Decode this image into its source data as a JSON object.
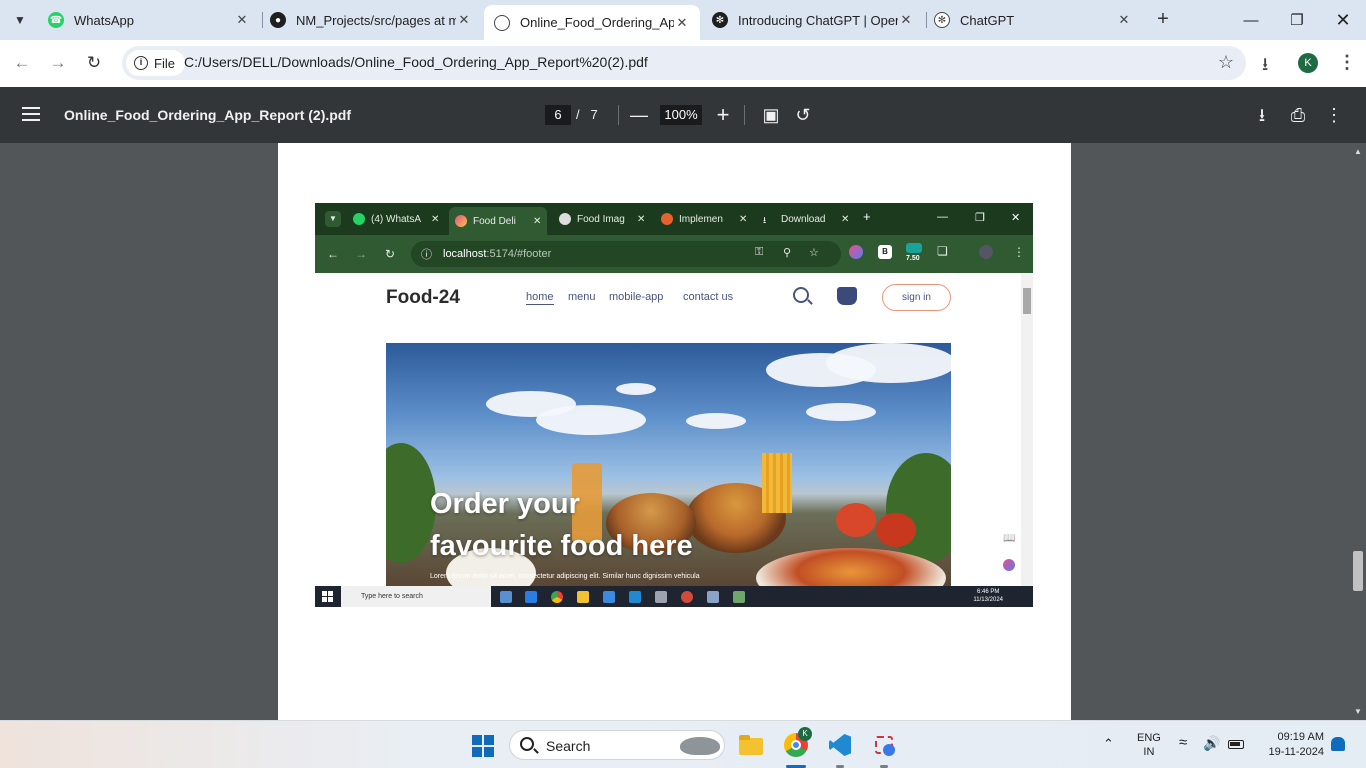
{
  "browser": {
    "tabs": [
      {
        "title": "WhatsApp",
        "icon": "whatsapp-icon",
        "active": false
      },
      {
        "title": "NM_Projects/src/pages at m",
        "icon": "github-icon",
        "active": false
      },
      {
        "title": "Online_Food_Ordering_App_",
        "icon": "globe-icon",
        "active": true
      },
      {
        "title": "Introducing ChatGPT | Open",
        "icon": "openai-icon",
        "active": false
      },
      {
        "title": "ChatGPT",
        "icon": "openai-icon",
        "active": false
      }
    ],
    "address": {
      "chip_label": "File",
      "url": "C:/Users/DELL/Downloads/Online_Food_Ordering_App_Report%20(2).pdf"
    },
    "profile_initial": "K"
  },
  "pdf_viewer": {
    "document_name": "Online_Food_Ordering_App_Report (2).pdf",
    "current_page": "6",
    "page_separator": "/",
    "total_pages": "7",
    "zoom": "100%"
  },
  "embedded_screenshot": {
    "tabs": [
      {
        "title": "(4) WhatsA",
        "active": false
      },
      {
        "title": "Food Deli",
        "active": true
      },
      {
        "title": "Food Imag",
        "active": false
      },
      {
        "title": "Implemen",
        "active": false
      },
      {
        "title": "Download",
        "active": false
      }
    ],
    "url_host": "localhost",
    "url_rest": ":5174/#footer",
    "extension_badge": "7.50",
    "extension_b": "B",
    "site": {
      "logo": "Food-24",
      "menu": [
        "home",
        "menu",
        "mobile-app",
        "contact us"
      ],
      "active_menu": "home",
      "signin_label": "sign in",
      "hero_title_line1": "Order your",
      "hero_title_line2": "favourite food here",
      "hero_subtext": "Lorem ipsum dolor sit amet, consectetur adipiscing elit. Similar hunc dignissim vehicula"
    },
    "taskbar": {
      "search_placeholder": "Type here to search",
      "time": "6:46 PM",
      "date": "11/13/2024"
    }
  },
  "windows_taskbar": {
    "search_label": "Search",
    "language_line1": "ENG",
    "language_line2": "IN",
    "time": "09:19 AM",
    "date": "19-11-2024",
    "chrome_badge": "K"
  },
  "colors": {
    "tabstrip_bg": "#dbe4f1",
    "pdf_toolbar_bg": "#323639",
    "pdf_canvas_bg": "#525659",
    "embedded_chrome_bg": "#1c3a1e",
    "accent_blue": "#0f6cbd"
  }
}
